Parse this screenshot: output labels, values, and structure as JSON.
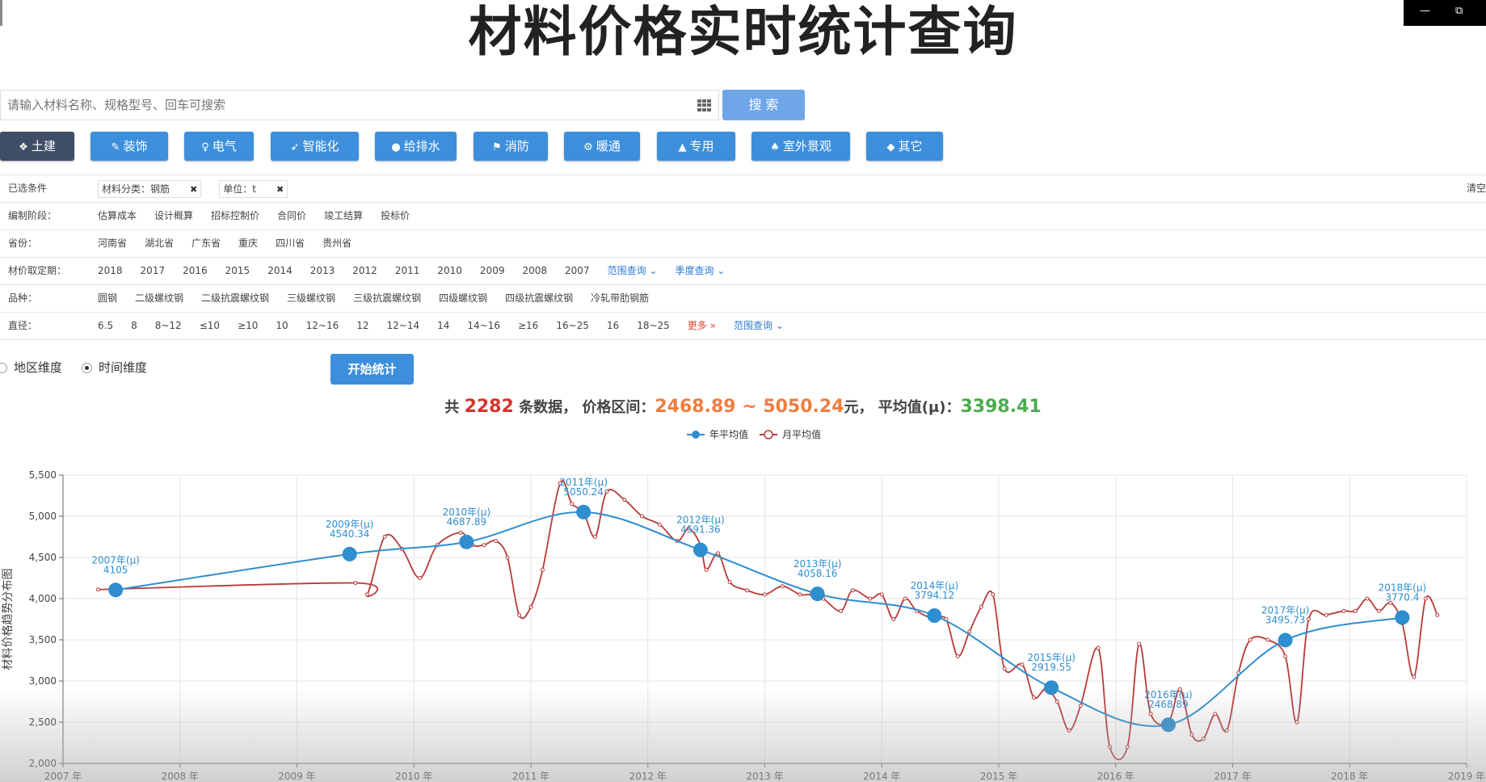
{
  "page": {
    "title": "材料价格实时统计查询"
  },
  "window": {
    "minimize": "—",
    "restore": "⧉"
  },
  "search": {
    "placeholder": "请输入材料名称、规格型号、回车可搜索",
    "button": "搜 索"
  },
  "categories": [
    {
      "label": "土建",
      "icon": "dropbox-icon",
      "glyph": "❖",
      "active": true
    },
    {
      "label": "装饰",
      "icon": "paint-brush-icon",
      "glyph": "✎",
      "active": false
    },
    {
      "label": "电气",
      "icon": "lightbulb-icon",
      "glyph": "♀",
      "active": false
    },
    {
      "label": "智能化",
      "icon": "rocket-icon",
      "glyph": "➶",
      "active": false
    },
    {
      "label": "给排水",
      "icon": "water-drop-icon",
      "glyph": "●",
      "active": false
    },
    {
      "label": "消防",
      "icon": "fire-extinguisher-icon",
      "glyph": "⚑",
      "active": false
    },
    {
      "label": "暖通",
      "icon": "gear-icon",
      "glyph": "⚙",
      "active": false
    },
    {
      "label": "专用",
      "icon": "road-icon",
      "glyph": "▲",
      "active": false
    },
    {
      "label": "室外景观",
      "icon": "tree-icon",
      "glyph": "♠",
      "active": false
    },
    {
      "label": "其它",
      "icon": "tag-icon",
      "glyph": "◆",
      "active": false
    }
  ],
  "filters": {
    "selected_label": "已选条件",
    "selected_tags": [
      "材料分类：钢筋",
      "单位：t"
    ],
    "clear": "清空",
    "rows": [
      {
        "label": "编制阶段：",
        "options": [
          "估算成本",
          "设计概算",
          "招标控制价",
          "合同价",
          "竣工结算",
          "投标价"
        ]
      },
      {
        "label": "省份：",
        "options": [
          "河南省",
          "湖北省",
          "广东省",
          "重庆",
          "四川省",
          "贵州省"
        ]
      },
      {
        "label": "材价取定期：",
        "options": [
          "2018",
          "2017",
          "2016",
          "2015",
          "2014",
          "2013",
          "2012",
          "2011",
          "2010",
          "2009",
          "2008",
          "2007"
        ],
        "extra": [
          "范围查询 ⌄",
          "季度查询 ⌄"
        ]
      },
      {
        "label": "品种：",
        "options": [
          "圆钢",
          "二级螺纹钢",
          "二级抗震螺纹钢",
          "三级螺纹钢",
          "三级抗震螺纹钢",
          "四级螺纹钢",
          "四级抗震螺纹钢",
          "冷轧带肋钢筋"
        ]
      },
      {
        "label": "直径：",
        "options": [
          "6.5",
          "8",
          "8~12",
          "≤10",
          "≥10",
          "10",
          "12~16",
          "12",
          "12~14",
          "14",
          "14~16",
          "≥16",
          "16~25",
          "16",
          "18~25"
        ],
        "more": "更多 »",
        "extra": [
          "范围查询 ⌄"
        ]
      }
    ]
  },
  "dimension": {
    "region": "地区维度",
    "time": "时间维度",
    "selected": "time"
  },
  "start_button": "开始统计",
  "summary": {
    "prefix": "共",
    "count": "2282",
    "mid": "条数据，  价格区间：",
    "range": "2468.89 ~ 5050.24",
    "unit": "元，  平均值(μ)：",
    "avg": "3398.41"
  },
  "chart_data": {
    "type": "line",
    "ylabel": "材料价格趋势分布图",
    "ylim": [
      2000,
      5500
    ],
    "yticks": [
      "5,500",
      "5,000",
      "4,500",
      "4,000",
      "3,500",
      "3,000",
      "2,500",
      "2,000"
    ],
    "xticks": [
      "2007 年",
      "2008 年",
      "2009 年",
      "2010 年",
      "2011 年",
      "2012 年",
      "2013 年",
      "2014 年",
      "2015 年",
      "2016 年",
      "2017 年",
      "2018 年",
      "2019 年"
    ],
    "xlim": [
      2007,
      2019
    ],
    "legend": [
      "年平均值",
      "月平均值"
    ],
    "colors": {
      "year": "#2e8ecf",
      "month": "#b83a3a"
    },
    "series": [
      {
        "name": "年平均值",
        "points": [
          {
            "x": 2007.45,
            "y": 4105,
            "label": "2007年(μ)",
            "value": "4105"
          },
          {
            "x": 2009.45,
            "y": 4540.34,
            "label": "2009年(μ)",
            "value": "4540.34"
          },
          {
            "x": 2010.45,
            "y": 4687.89,
            "label": "2010年(μ)",
            "value": "4687.89"
          },
          {
            "x": 2011.45,
            "y": 5050.24,
            "label": "2011年(μ)",
            "value": "5050.24"
          },
          {
            "x": 2012.45,
            "y": 4591.36,
            "label": "2012年(μ)",
            "value": "4591.36"
          },
          {
            "x": 2013.45,
            "y": 4058.16,
            "label": "2013年(μ)",
            "value": "4058.16"
          },
          {
            "x": 2014.45,
            "y": 3794.12,
            "label": "2014年(μ)",
            "value": "3794.12"
          },
          {
            "x": 2015.45,
            "y": 2919.55,
            "label": "2015年(μ)",
            "value": "2919.55"
          },
          {
            "x": 2016.45,
            "y": 2468.89,
            "label": "2016年(μ)",
            "value": "2468.89"
          },
          {
            "x": 2017.45,
            "y": 3495.73,
            "label": "2017年(μ)",
            "value": "3495.73"
          },
          {
            "x": 2018.45,
            "y": 3770.4,
            "label": "2018年(μ)",
            "value": "3770.4"
          }
        ]
      },
      {
        "name": "月平均值",
        "points": [
          [
            2007.3,
            4110
          ],
          [
            2009.5,
            4190
          ],
          [
            2009.6,
            4050
          ],
          [
            2009.75,
            4750
          ],
          [
            2009.9,
            4600
          ],
          [
            2010.05,
            4250
          ],
          [
            2010.2,
            4650
          ],
          [
            2010.4,
            4800
          ],
          [
            2010.5,
            4650
          ],
          [
            2010.6,
            4650
          ],
          [
            2010.7,
            4700
          ],
          [
            2010.8,
            4500
          ],
          [
            2010.9,
            3800
          ],
          [
            2011.0,
            3900
          ],
          [
            2011.1,
            4350
          ],
          [
            2011.25,
            5400
          ],
          [
            2011.35,
            5150
          ],
          [
            2011.45,
            5050
          ],
          [
            2011.55,
            4750
          ],
          [
            2011.65,
            5300
          ],
          [
            2011.8,
            5200
          ],
          [
            2011.95,
            5000
          ],
          [
            2012.1,
            4900
          ],
          [
            2012.25,
            4700
          ],
          [
            2012.35,
            4850
          ],
          [
            2012.45,
            4650
          ],
          [
            2012.5,
            4350
          ],
          [
            2012.6,
            4550
          ],
          [
            2012.7,
            4200
          ],
          [
            2012.85,
            4100
          ],
          [
            2013.0,
            4050
          ],
          [
            2013.15,
            4150
          ],
          [
            2013.3,
            4050
          ],
          [
            2013.4,
            4050
          ],
          [
            2013.5,
            4000
          ],
          [
            2013.65,
            3850
          ],
          [
            2013.75,
            4100
          ],
          [
            2013.9,
            4000
          ],
          [
            2014.0,
            4050
          ],
          [
            2014.1,
            3750
          ],
          [
            2014.2,
            4000
          ],
          [
            2014.3,
            3850
          ],
          [
            2014.45,
            3750
          ],
          [
            2014.55,
            3750
          ],
          [
            2014.65,
            3300
          ],
          [
            2014.75,
            3600
          ],
          [
            2014.85,
            3900
          ],
          [
            2014.95,
            4050
          ],
          [
            2015.05,
            3150
          ],
          [
            2015.2,
            3200
          ],
          [
            2015.3,
            2800
          ],
          [
            2015.4,
            2900
          ],
          [
            2015.5,
            2750
          ],
          [
            2015.6,
            2400
          ],
          [
            2015.7,
            2700
          ],
          [
            2015.85,
            3400
          ],
          [
            2015.95,
            2200
          ],
          [
            2016.1,
            2200
          ],
          [
            2016.2,
            3450
          ],
          [
            2016.3,
            2600
          ],
          [
            2016.45,
            2500
          ],
          [
            2016.55,
            2900
          ],
          [
            2016.65,
            2350
          ],
          [
            2016.75,
            2300
          ],
          [
            2016.85,
            2600
          ],
          [
            2016.95,
            2400
          ],
          [
            2017.05,
            3100
          ],
          [
            2017.15,
            3500
          ],
          [
            2017.3,
            3500
          ],
          [
            2017.45,
            3300
          ],
          [
            2017.55,
            2500
          ],
          [
            2017.65,
            3750
          ],
          [
            2017.8,
            3800
          ],
          [
            2017.95,
            3850
          ],
          [
            2018.05,
            3850
          ],
          [
            2018.15,
            4000
          ],
          [
            2018.25,
            3850
          ],
          [
            2018.35,
            3950
          ],
          [
            2018.45,
            3700
          ],
          [
            2018.55,
            3050
          ],
          [
            2018.65,
            4000
          ],
          [
            2018.75,
            3800
          ]
        ]
      }
    ]
  }
}
